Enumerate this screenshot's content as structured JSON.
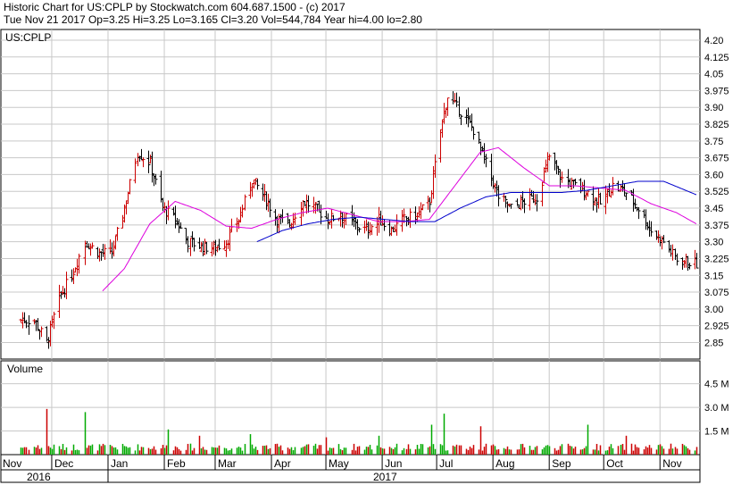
{
  "header": {
    "line1": "Historic Chart for US:CPLP by Stockwatch.com 604.687.1500 - (c) 2017",
    "line2": "Tue Nov 21 2017  Op=3.25  Hi=3.25  Lo=3.165  Cl=3.20  Vol=544,784  Year hi=4.00  lo=2.80"
  },
  "price_panel": {
    "symbol": "US:CPLP",
    "tick_labels": [
      "4.20",
      "4.125",
      "4.05",
      "3.975",
      "3.90",
      "3.825",
      "3.75",
      "3.675",
      "3.60",
      "3.525",
      "3.45",
      "3.375",
      "3.30",
      "3.225",
      "3.15",
      "3.075",
      "3.00",
      "2.925",
      "2.85"
    ]
  },
  "volume_panel": {
    "title": "Volume",
    "tick_labels": [
      "4.5 M",
      "3.0 M",
      "1.5 M"
    ]
  },
  "x_axis": {
    "months": [
      "Nov",
      "Dec",
      "Jan",
      "Feb",
      "Mar",
      "Apr",
      "May",
      "Jun",
      "Jul",
      "Aug",
      "Sep",
      "Oct",
      "Nov"
    ],
    "years": [
      "2016",
      "2017"
    ]
  },
  "colors": {
    "up": "#cc0000",
    "down": "#000000",
    "ma_short": "#dd00dd",
    "ma_long": "#0000cc",
    "vol_up": "#00aa00",
    "vol_down": "#cc0000"
  },
  "chart_data": {
    "type": "ohlc",
    "price_ylim": [
      2.8,
      4.2
    ],
    "volume_ylim": [
      0,
      5.5
    ],
    "volume_unit": "M",
    "close_anchors": [
      [
        "2016-11-21",
        2.95
      ],
      [
        "2016-11-28",
        2.85
      ],
      [
        "2016-12-05",
        3.05
      ],
      [
        "2016-12-12",
        3.15
      ],
      [
        "2016-12-19",
        3.3
      ],
      [
        "2016-12-27",
        3.25
      ],
      [
        "2017-01-03",
        3.25
      ],
      [
        "2017-01-10",
        3.45
      ],
      [
        "2017-01-17",
        3.7
      ],
      [
        "2017-01-24",
        3.65
      ],
      [
        "2017-01-31",
        3.45
      ],
      [
        "2017-02-07",
        3.4
      ],
      [
        "2017-02-14",
        3.3
      ],
      [
        "2017-02-21",
        3.28
      ],
      [
        "2017-02-28",
        3.27
      ],
      [
        "2017-03-07",
        3.3
      ],
      [
        "2017-03-14",
        3.4
      ],
      [
        "2017-03-21",
        3.58
      ],
      [
        "2017-03-28",
        3.5
      ],
      [
        "2017-04-04",
        3.4
      ],
      [
        "2017-04-11",
        3.38
      ],
      [
        "2017-04-18",
        3.48
      ],
      [
        "2017-04-25",
        3.45
      ],
      [
        "2017-05-02",
        3.4
      ],
      [
        "2017-05-09",
        3.42
      ],
      [
        "2017-05-16",
        3.38
      ],
      [
        "2017-05-23",
        3.35
      ],
      [
        "2017-05-30",
        3.4
      ],
      [
        "2017-06-06",
        3.35
      ],
      [
        "2017-06-13",
        3.4
      ],
      [
        "2017-06-20",
        3.42
      ],
      [
        "2017-06-27",
        3.48
      ],
      [
        "2017-07-03",
        3.8
      ],
      [
        "2017-07-07",
        3.95
      ],
      [
        "2017-07-14",
        3.88
      ],
      [
        "2017-07-21",
        3.8
      ],
      [
        "2017-07-28",
        3.65
      ],
      [
        "2017-08-04",
        3.5
      ],
      [
        "2017-08-11",
        3.45
      ],
      [
        "2017-08-18",
        3.48
      ],
      [
        "2017-08-25",
        3.5
      ],
      [
        "2017-09-01",
        3.68
      ],
      [
        "2017-09-08",
        3.58
      ],
      [
        "2017-09-15",
        3.55
      ],
      [
        "2017-09-22",
        3.52
      ],
      [
        "2017-09-29",
        3.47
      ],
      [
        "2017-10-06",
        3.55
      ],
      [
        "2017-10-13",
        3.52
      ],
      [
        "2017-10-20",
        3.45
      ],
      [
        "2017-10-27",
        3.35
      ],
      [
        "2017-11-03",
        3.3
      ],
      [
        "2017-11-10",
        3.22
      ],
      [
        "2017-11-17",
        3.21
      ],
      [
        "2017-11-21",
        3.2
      ]
    ],
    "ma_short_anchors": [
      [
        "2016-12-29",
        3.08
      ],
      [
        "2017-01-10",
        3.18
      ],
      [
        "2017-01-24",
        3.38
      ],
      [
        "2017-02-07",
        3.48
      ],
      [
        "2017-02-21",
        3.44
      ],
      [
        "2017-03-07",
        3.37
      ],
      [
        "2017-03-21",
        3.36
      ],
      [
        "2017-04-04",
        3.4
      ],
      [
        "2017-04-18",
        3.43
      ],
      [
        "2017-05-02",
        3.45
      ],
      [
        "2017-05-16",
        3.42
      ],
      [
        "2017-05-30",
        3.39
      ],
      [
        "2017-06-13",
        3.39
      ],
      [
        "2017-06-27",
        3.4
      ],
      [
        "2017-07-11",
        3.55
      ],
      [
        "2017-07-25",
        3.7
      ],
      [
        "2017-08-04",
        3.72
      ],
      [
        "2017-08-18",
        3.63
      ],
      [
        "2017-09-01",
        3.55
      ],
      [
        "2017-09-15",
        3.55
      ],
      [
        "2017-09-29",
        3.54
      ],
      [
        "2017-10-13",
        3.53
      ],
      [
        "2017-10-27",
        3.47
      ],
      [
        "2017-11-10",
        3.43
      ],
      [
        "2017-11-21",
        3.38
      ]
    ],
    "ma_long_anchors": [
      [
        "2017-03-24",
        3.3
      ],
      [
        "2017-04-07",
        3.35
      ],
      [
        "2017-04-21",
        3.38
      ],
      [
        "2017-05-05",
        3.4
      ],
      [
        "2017-05-19",
        3.41
      ],
      [
        "2017-06-02",
        3.4
      ],
      [
        "2017-06-16",
        3.39
      ],
      [
        "2017-06-30",
        3.39
      ],
      [
        "2017-07-14",
        3.45
      ],
      [
        "2017-07-28",
        3.5
      ],
      [
        "2017-08-11",
        3.52
      ],
      [
        "2017-08-25",
        3.52
      ],
      [
        "2017-09-08",
        3.52
      ],
      [
        "2017-09-22",
        3.53
      ],
      [
        "2017-10-06",
        3.55
      ],
      [
        "2017-10-20",
        3.57
      ],
      [
        "2017-11-03",
        3.57
      ],
      [
        "2017-11-21",
        3.51
      ]
    ],
    "volume_anchors": [
      [
        "2016-11-28",
        2.9
      ],
      [
        "2016-12-19",
        2.7
      ],
      [
        "2017-02-03",
        1.6
      ],
      [
        "2017-02-20",
        1.2
      ],
      [
        "2017-03-20",
        1.3
      ],
      [
        "2017-05-01",
        1.1
      ],
      [
        "2017-05-30",
        1.2
      ],
      [
        "2017-06-28",
        1.9
      ],
      [
        "2017-07-05",
        2.6
      ],
      [
        "2017-07-25",
        1.8
      ],
      [
        "2017-09-22",
        1.9
      ],
      [
        "2017-10-13",
        1.2
      ]
    ]
  }
}
